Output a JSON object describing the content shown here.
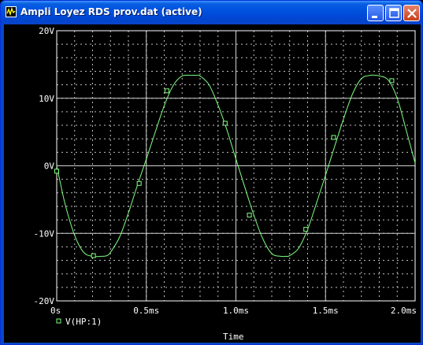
{
  "window": {
    "title": "Ampli Loyez RDS prov.dat (active)",
    "icons": {
      "app": "probe-app-icon",
      "minimize": "minimize-icon",
      "maximize": "maximize-icon",
      "close": "close-icon"
    }
  },
  "chart_data": {
    "type": "line",
    "xlabel": "Time",
    "xlim": [
      0,
      2.0
    ],
    "x_unit": "ms",
    "ylim": [
      -20,
      20
    ],
    "y_unit": "V",
    "x_ticks": [
      {
        "value": 0,
        "label": "0s"
      },
      {
        "value": 0.5,
        "label": "0.5ms"
      },
      {
        "value": 1.0,
        "label": "1.0ms"
      },
      {
        "value": 1.5,
        "label": "1.5ms"
      },
      {
        "value": 2.0,
        "label": "2.0ms"
      }
    ],
    "y_ticks": [
      {
        "value": 20,
        "label": "20V"
      },
      {
        "value": 10,
        "label": "10V"
      },
      {
        "value": 0,
        "label": "0V"
      },
      {
        "value": -10,
        "label": "-10V"
      },
      {
        "value": -20,
        "label": "-20V"
      }
    ],
    "grid": true,
    "background": "#000000",
    "axis_color": "#ffffff",
    "grid_color": "#c0c0c0",
    "series": [
      {
        "name": "V(HP:1)",
        "color": "#80ff80",
        "marker": "square",
        "x": [
          0,
          0.02,
          0.05,
          0.1,
          0.15,
          0.2,
          0.25,
          0.28,
          0.3,
          0.35,
          0.4,
          0.45,
          0.5,
          0.55,
          0.6,
          0.65,
          0.7,
          0.75,
          0.78,
          0.8,
          0.85,
          0.9,
          0.95,
          1.0,
          1.05,
          1.1,
          1.15,
          1.2,
          1.25,
          1.28,
          1.3,
          1.35,
          1.4,
          1.45,
          1.5,
          1.55,
          1.6,
          1.65,
          1.7,
          1.75,
          1.78,
          1.8,
          1.85,
          1.9,
          1.95,
          2.0
        ],
        "y": [
          0,
          -2.5,
          -6.0,
          -10.3,
          -12.8,
          -13.4,
          -13.4,
          -13.3,
          -12.8,
          -10.6,
          -7.0,
          -2.9,
          1.0,
          5.0,
          8.9,
          11.9,
          13.3,
          13.4,
          13.4,
          13.3,
          12.0,
          9.0,
          5.3,
          1.0,
          -3.2,
          -7.3,
          -10.8,
          -13.0,
          -13.4,
          -13.4,
          -13.3,
          -12.2,
          -9.4,
          -5.5,
          -1.4,
          2.8,
          6.9,
          10.6,
          12.9,
          13.4,
          13.4,
          13.3,
          12.7,
          10.0,
          5.3,
          0.4
        ],
        "marker_points": [
          {
            "x": 0.0,
            "y": -0.8
          },
          {
            "x": 0.205,
            "y": -13.3
          },
          {
            "x": 0.46,
            "y": -2.6
          },
          {
            "x": 0.615,
            "y": 11.1
          },
          {
            "x": 0.94,
            "y": 6.3
          },
          {
            "x": 1.075,
            "y": -7.3
          },
          {
            "x": 1.39,
            "y": -9.4
          },
          {
            "x": 1.545,
            "y": 4.2
          },
          {
            "x": 1.87,
            "y": 12.6
          }
        ]
      }
    ]
  }
}
